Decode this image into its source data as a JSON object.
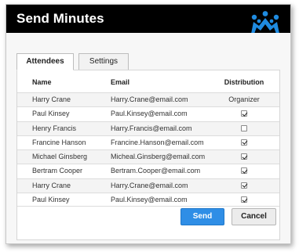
{
  "dialog": {
    "title": "Send Minutes",
    "logo": "crown-people-icon",
    "colors": {
      "titlebar": "#000000",
      "logo": "#1f8be0",
      "primary_button": "#2f8ee6"
    }
  },
  "tabs": [
    {
      "label": "Attendees",
      "active": true
    },
    {
      "label": "Settings",
      "active": false
    }
  ],
  "table": {
    "headers": {
      "name": "Name",
      "email": "Email",
      "distribution": "Distribution"
    },
    "rows": [
      {
        "name": "Harry Crane",
        "email": "Harry.Crane@email.com",
        "distribution": "Organizer"
      },
      {
        "name": "Paul Kinsey",
        "email": "Paul.Kinsey@email.com",
        "distribution": true
      },
      {
        "name": "Henry Francis",
        "email": "Harry.Francis@email.com",
        "distribution": false
      },
      {
        "name": "Francine Hanson",
        "email": "Francine.Hanson@email.com",
        "distribution": true
      },
      {
        "name": "Michael Ginsberg",
        "email": "Micheal.Ginsberg@email.com",
        "distribution": true
      },
      {
        "name": "Bertram Cooper",
        "email": "Bertram.Cooper@email.com",
        "distribution": true
      },
      {
        "name": "Harry Crane",
        "email": "Harry.Crane@email.com",
        "distribution": true
      },
      {
        "name": "Paul Kinsey",
        "email": "Paul.Kinsey@email.com",
        "distribution": true
      }
    ]
  },
  "buttons": {
    "send": "Send",
    "cancel": "Cancel"
  }
}
